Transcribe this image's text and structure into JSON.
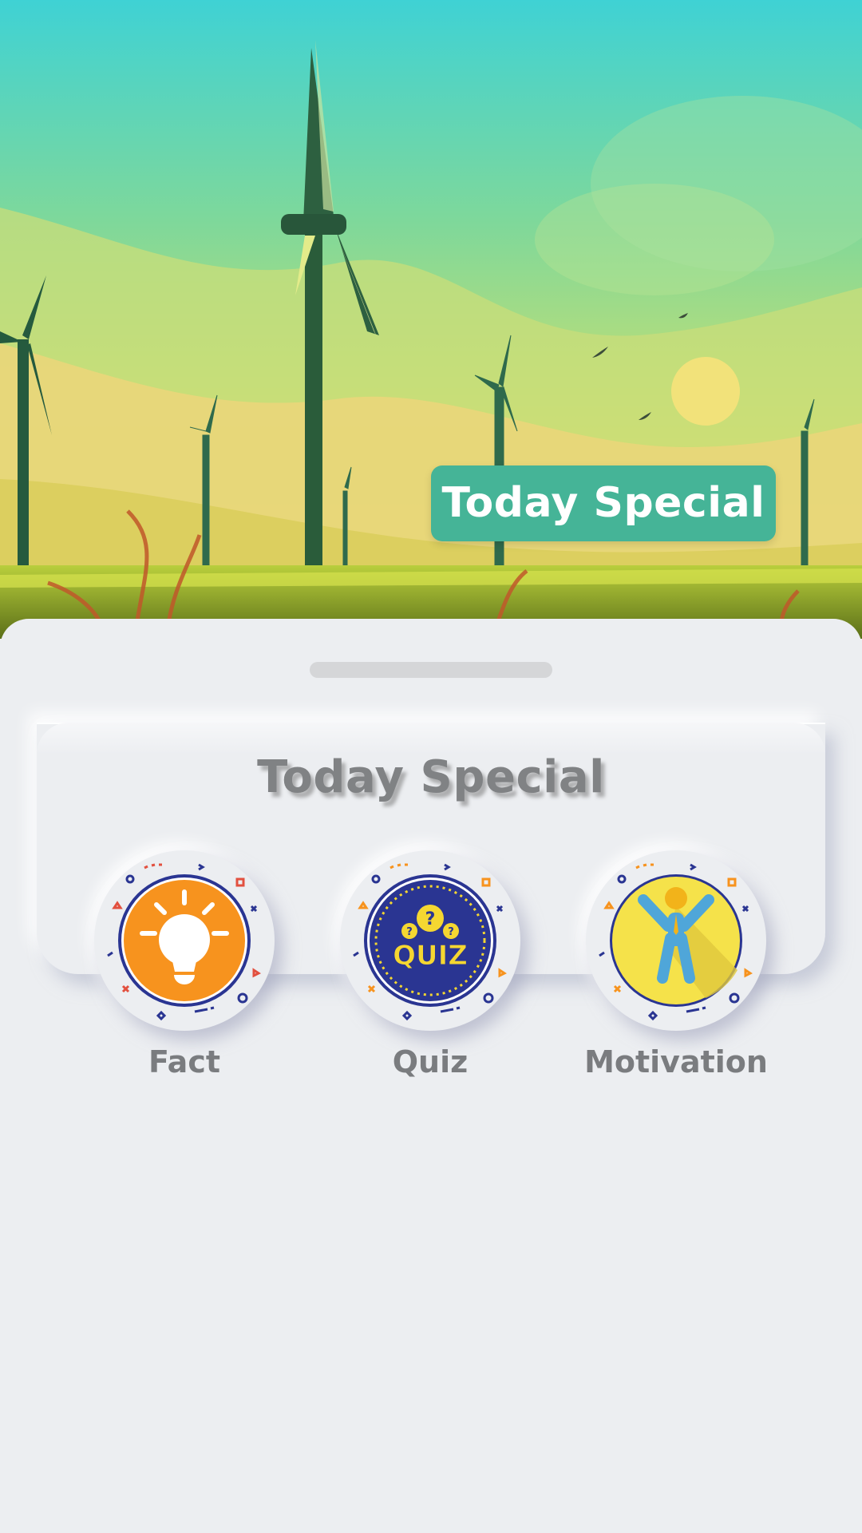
{
  "hero": {
    "badge_label": "Today Special"
  },
  "card": {
    "title": "Today Special"
  },
  "categories": [
    {
      "label": "Fact",
      "icon": "lightbulb-icon",
      "color": "#f7931e"
    },
    {
      "label": "Quiz",
      "icon": "quiz-icon",
      "color": "#2a3592",
      "icon_text": "QUIZ"
    },
    {
      "label": "Motivation",
      "icon": "motivation-person-icon",
      "color": "#f5e24a"
    }
  ],
  "colors": {
    "badge": "#45b497",
    "background": "#eceef1",
    "label": "#7a7c7f"
  }
}
